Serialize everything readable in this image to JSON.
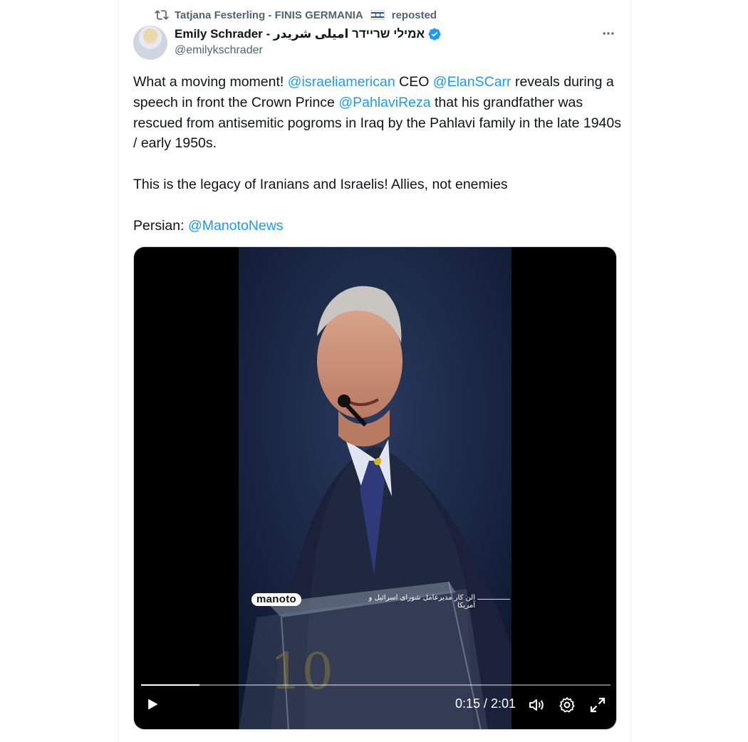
{
  "repost": {
    "name": "Tatjana Festerling - FINIS GERMANIA",
    "label": "reposted"
  },
  "author": {
    "display_name": "Emily Schrader - אמילי שריידר امیلی شریدر",
    "handle": "@emilykschrader"
  },
  "tweet": {
    "segments": [
      {
        "text": "What a moving moment! ",
        "type": "text"
      },
      {
        "text": "@israeliamerican",
        "type": "mention"
      },
      {
        "text": " CEO ",
        "type": "text"
      },
      {
        "text": "@ElanSCarr",
        "type": "mention"
      },
      {
        "text": " reveals during a speech in front the Crown Prince ",
        "type": "text"
      },
      {
        "text": "@PahlaviReza",
        "type": "mention"
      },
      {
        "text": " that his grandfather was rescued from antisemitic pogroms in Iraq by the Pahlavi family in the late 1940s / early 1950s.\n\nThis is the legacy of Iranians and Israelis! Allies, not enemies\n\nPersian: ",
        "type": "text"
      },
      {
        "text": "@ManotoNews",
        "type": "mention"
      }
    ]
  },
  "video": {
    "logo_text": "manoto",
    "caption": "الن کار مدیرعامل شورای اسرائیل و آمریکا",
    "time": "0:15 / 2:01",
    "progress": 0.124
  },
  "icons": {
    "repost": "repost-icon",
    "verified": "verified-badge-icon",
    "more": "more-icon",
    "play": "play-icon",
    "volume": "volume-icon",
    "settings": "settings-icon",
    "fullscreen": "fullscreen-icon"
  },
  "colors": {
    "accent": "#1d9bf0",
    "text": "#0f1419",
    "muted": "#536471"
  }
}
